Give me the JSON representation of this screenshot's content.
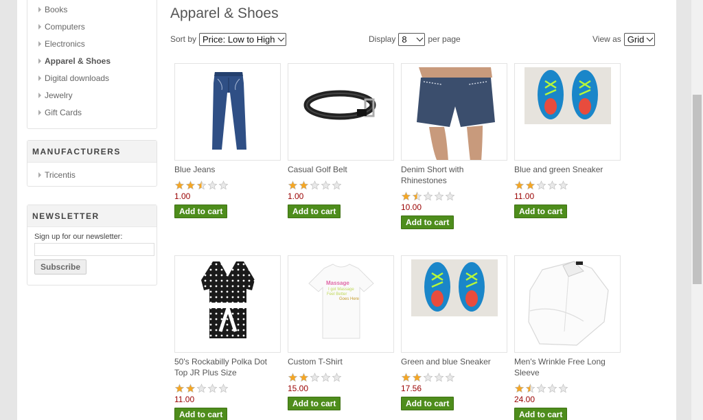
{
  "sidebar": {
    "categories": [
      {
        "label": "Books"
      },
      {
        "label": "Computers"
      },
      {
        "label": "Electronics"
      },
      {
        "label": "Apparel & Shoes",
        "active": true
      },
      {
        "label": "Digital downloads"
      },
      {
        "label": "Jewelry"
      },
      {
        "label": "Gift Cards"
      }
    ],
    "manufacturers_title": "MANUFACTURERS",
    "manufacturers": [
      {
        "label": "Tricentis"
      }
    ],
    "newsletter_title": "NEWSLETTER",
    "newsletter_label": "Sign up for our newsletter:",
    "newsletter_value": "",
    "subscribe_label": "Subscribe"
  },
  "main": {
    "title": "Apparel & Shoes",
    "sort_label": "Sort by",
    "sort_value": "Price: Low to High",
    "display_label": "Display",
    "display_value": "8",
    "per_page_label": "per page",
    "view_label": "View as",
    "view_value": "Grid",
    "add_to_cart_label": "Add to cart",
    "products": [
      {
        "name": "Blue Jeans",
        "price": "1.00",
        "rating": 2.5,
        "image": "jeans"
      },
      {
        "name": "Casual Golf Belt",
        "price": "1.00",
        "rating": 2,
        "image": "belt"
      },
      {
        "name": "Denim Short with Rhinestones",
        "price": "10.00",
        "rating": 1.5,
        "image": "shorts"
      },
      {
        "name": "Blue and green Sneaker",
        "price": "11.00",
        "rating": 2,
        "image": "sneaker"
      },
      {
        "name": "50's Rockabilly Polka Dot Top JR Plus Size",
        "price": "11.00",
        "rating": 2,
        "image": "polka-top"
      },
      {
        "name": "Custom T-Shirt",
        "price": "15.00",
        "rating": 2,
        "image": "tshirt"
      },
      {
        "name": "Green and blue Sneaker",
        "price": "17.56",
        "rating": 2,
        "image": "sneaker"
      },
      {
        "name": "Men's Wrinkle Free Long Sleeve",
        "price": "24.00",
        "rating": 1.5,
        "image": "dress-shirt"
      }
    ],
    "tshirt_print": [
      "Massage",
      "I got Massage",
      "Feel Better",
      "Goes Here"
    ]
  },
  "colors": {
    "star": "#f5a623",
    "star_empty": "#e8e8e8",
    "price": "#990000",
    "cart_button": "#4e8d1c"
  }
}
